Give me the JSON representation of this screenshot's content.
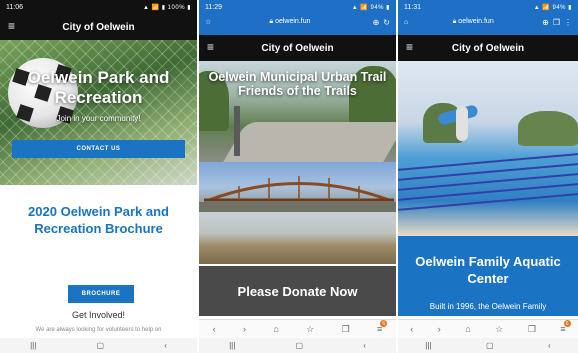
{
  "phone1": {
    "status_time": "11:06",
    "status_right": "▲ 📶 ▮ 100% ▮",
    "header_title": "City of Oelwein",
    "hero_title": "Oelwein Park and Recreation",
    "hero_subtitle": "Join in your community!",
    "contact_button": "CONTACT US",
    "brochure_title": "2020 Oelwein Park and Recreation Brochure",
    "brochure_button": "BROCHURE",
    "get_involved": "Get Involved!",
    "volunteers_text": "We are always looking for volunteers to help on"
  },
  "phone2": {
    "status_time": "11:29",
    "status_right": "▲ 📶 94% ▮",
    "url": "oelwein.fun",
    "header_title": "City of Oelwein",
    "trail_title": "Oelwein Municipal Urban Trail Friends of the Trails",
    "donate_text": "Please Donate Now",
    "tab_badge": "6"
  },
  "phone3": {
    "status_time": "11:31",
    "status_right": "▲ 📶 94% ▮",
    "url": "oelwein.fun",
    "header_title": "City of Oelwein",
    "aquatic_title": "Oelwein Family Aquatic Center",
    "aquatic_text": "Built in 1996, the Oelwein Family",
    "tab_badge": "6"
  },
  "colors": {
    "accent_blue": "#1b73c4",
    "header_dark": "#111111",
    "donate_gray": "#4a4a4a"
  },
  "icons": {
    "menu": "hamburger-icon",
    "nav_recent": "recents-icon",
    "nav_home": "home-circle-icon",
    "nav_back": "back-icon"
  }
}
